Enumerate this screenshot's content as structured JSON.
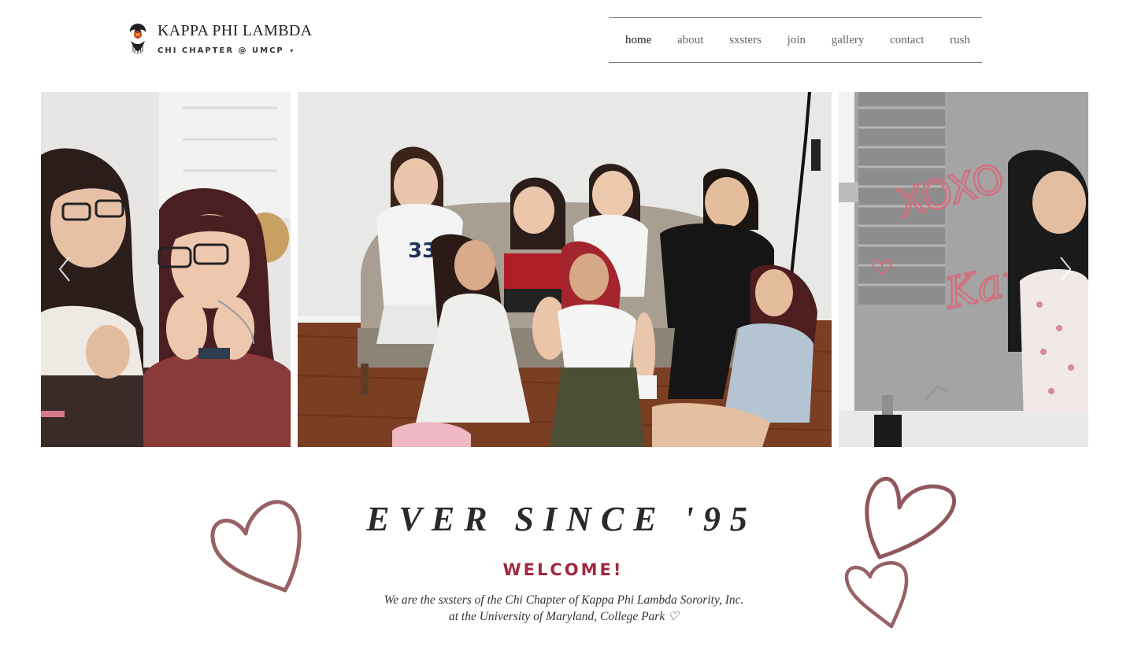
{
  "header": {
    "logo_title": "KAPPA PHI LAMBDA",
    "logo_subtitle": "CHI CHAPTER @ UMCP",
    "logo_caret": "▾",
    "logo_icon": "phoenix-crest-icon"
  },
  "nav": {
    "items": [
      {
        "label": "home",
        "active": true
      },
      {
        "label": "about"
      },
      {
        "label": "sxsters"
      },
      {
        "label": "join"
      },
      {
        "label": "gallery"
      },
      {
        "label": "contact"
      },
      {
        "label": "rush"
      }
    ]
  },
  "gallery": {
    "prev_icon": "chevron-left-icon",
    "next_icon": "chevron-right-icon",
    "right_photo_mirror_text": [
      "XOXO",
      "Kappa"
    ]
  },
  "hero": {
    "title": "EVER SINCE '95",
    "welcome": "WELCOME!",
    "intro_line1": "We are the sxsters of the Chi Chapter of Kappa Phi Lambda Sorority, Inc.",
    "intro_line2": "at the University of Maryland, College Park ♡"
  },
  "colors": {
    "accent": "#a0283f",
    "heart": "#6b1e24",
    "nav_border": "#777777"
  }
}
